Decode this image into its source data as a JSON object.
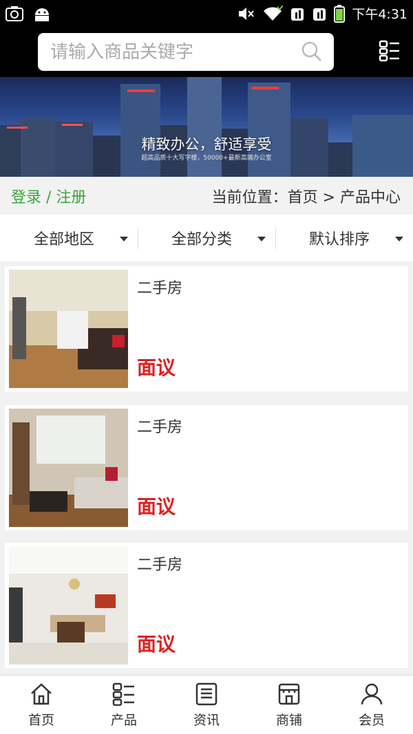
{
  "status_bar": {
    "time": "下午4:31"
  },
  "search": {
    "placeholder": "请输入商品关键字"
  },
  "banner": {
    "title": "精致办公，舒适享受",
    "subtitle": "超高品质十大写字楼，50000+最新高端办公室"
  },
  "breadcrumb": {
    "login_register": "登录 / 注册",
    "location": "当前位置：首页 > 产品中心"
  },
  "filters": [
    {
      "label": "全部地区"
    },
    {
      "label": "全部分类"
    },
    {
      "label": "默认排序"
    }
  ],
  "products": [
    {
      "title": "二手房",
      "price": "面议"
    },
    {
      "title": "二手房",
      "price": "面议"
    },
    {
      "title": "二手房",
      "price": "面议"
    }
  ],
  "bottom_nav": [
    {
      "label": "首页",
      "icon": "home-icon"
    },
    {
      "label": "产品",
      "icon": "product-icon"
    },
    {
      "label": "资讯",
      "icon": "news-icon"
    },
    {
      "label": "商铺",
      "icon": "shop-icon"
    },
    {
      "label": "会员",
      "icon": "member-icon"
    }
  ],
  "colors": {
    "accent_green": "#3aa53a",
    "price_red": "#e02020",
    "header_bg": "#000000"
  }
}
